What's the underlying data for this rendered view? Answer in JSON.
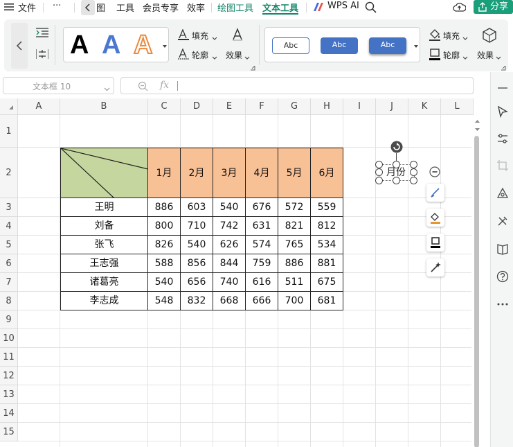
{
  "menu": {
    "file": "文件",
    "more": "···",
    "tabs": [
      "图",
      "工具",
      "会员专享",
      "效率",
      "绘图工具",
      "文本工具"
    ],
    "active_tab": "文本工具",
    "wps_ai": "WPS AI",
    "share": "分享"
  },
  "ribbon": {
    "fill": "填充",
    "outline": "轮廓",
    "effect": "效果",
    "abc": [
      "Abc",
      "Abc",
      "Abc"
    ],
    "fill2": "填充",
    "outline2": "轮廓",
    "effect2": "效果",
    "accent": "#4472c4"
  },
  "formula": {
    "name_box": "文本框 10",
    "fx": "fx",
    "value": ""
  },
  "sheet": {
    "columns": [
      "A",
      "B",
      "C",
      "D",
      "E",
      "F",
      "G",
      "H",
      "I",
      "J",
      "K",
      "L"
    ],
    "rows": [
      "1",
      "2",
      "3",
      "4",
      "5",
      "6",
      "7",
      "8",
      "9",
      "10",
      "11",
      "12",
      "13",
      "14",
      "15"
    ],
    "months": [
      "1月",
      "2月",
      "3月",
      "4月",
      "5月",
      "6月"
    ],
    "table": [
      {
        "name": "王明",
        "values": [
          "886",
          "603",
          "540",
          "676",
          "572",
          "559"
        ]
      },
      {
        "name": "刘备",
        "values": [
          "800",
          "710",
          "742",
          "631",
          "821",
          "812"
        ]
      },
      {
        "name": "张飞",
        "values": [
          "826",
          "540",
          "626",
          "574",
          "765",
          "534"
        ]
      },
      {
        "name": "王志强",
        "values": [
          "588",
          "856",
          "844",
          "759",
          "886",
          "881"
        ]
      },
      {
        "name": "诸葛亮",
        "values": [
          "540",
          "656",
          "740",
          "616",
          "511",
          "675"
        ]
      },
      {
        "name": "李志成",
        "values": [
          "548",
          "832",
          "668",
          "666",
          "700",
          "681"
        ]
      }
    ],
    "header_fill": "#c5d79e",
    "month_fill": "#f8c095"
  },
  "textbox": {
    "text": "月份"
  }
}
